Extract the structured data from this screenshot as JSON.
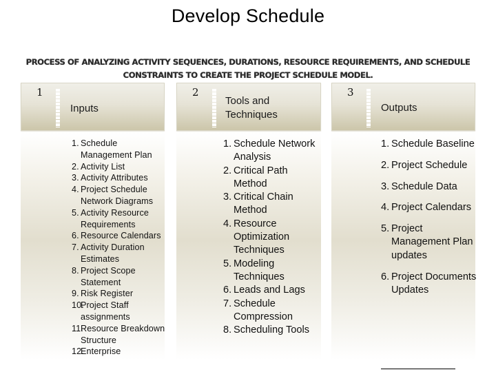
{
  "title": "Develop Schedule",
  "subtitle_line1": "PROCESS OF ANALYZING ACTIVITY SEQUENCES, DURATIONS, RESOURCE REQUIREMENTS, AND SCHEDULE",
  "subtitle_line2": "CONSTRAINTS TO CREATE THE PROJECT SCHEDULE MODEL.",
  "columns": [
    {
      "number": "1",
      "heading": "Inputs",
      "items": [
        {
          "n": "1.",
          "t": "Schedule Management Plan"
        },
        {
          "n": "2.",
          "t": "Activity List"
        },
        {
          "n": "3.",
          "t": "Activity Attributes"
        },
        {
          "n": "4.",
          "t": "Project Schedule Network Diagrams"
        },
        {
          "n": "5.",
          "t": "Activity Resource Requirements"
        },
        {
          "n": "6.",
          "t": "Resource Calendars"
        },
        {
          "n": "7.",
          "t": "Activity Duration Estimates"
        },
        {
          "n": "8.",
          "t": "Project Scope Statement"
        },
        {
          "n": "9.",
          "t": "Risk Register"
        },
        {
          "n": "10.",
          "t": "Project Staff assignments"
        },
        {
          "n": "11.",
          "t": "Resource Breakdown Structure"
        },
        {
          "n": "12.",
          "t": "Enterprise"
        }
      ]
    },
    {
      "number": "2",
      "heading": "Tools and Techniques",
      "items": [
        {
          "n": "1.",
          "t": "Schedule Network Analysis"
        },
        {
          "n": "2.",
          "t": "Critical Path Method"
        },
        {
          "n": "3.",
          "t": "Critical Chain Method"
        },
        {
          "n": "4.",
          "t": "Resource Optimization Techniques"
        },
        {
          "n": "5.",
          "t": "Modeling Techniques"
        },
        {
          "n": "6.",
          "t": "Leads and Lags"
        },
        {
          "n": "7.",
          "t": "Schedule Compression"
        },
        {
          "n": "8.",
          "t": "Scheduling Tools"
        }
      ]
    },
    {
      "number": "3",
      "heading": "Outputs",
      "items": [
        {
          "n": "1.",
          "t": "Schedule Baseline"
        },
        {
          "n": "2.",
          "t": "Project Schedule"
        },
        {
          "n": "3.",
          "t": "Schedule Data"
        },
        {
          "n": "4.",
          "t": "Project Calendars"
        },
        {
          "n": "5.",
          "t": "Project Management Plan updates"
        },
        {
          "n": "6.",
          "t": "Project Documents Updates"
        }
      ]
    }
  ]
}
